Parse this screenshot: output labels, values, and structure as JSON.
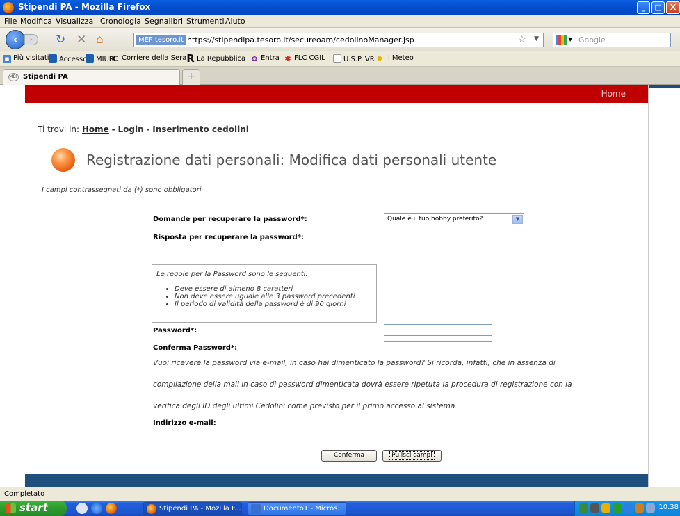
{
  "window": {
    "title": "Stipendi PA - Mozilla Firefox",
    "minimize": "_",
    "maximize": "□",
    "close": "X"
  },
  "menu": [
    "File",
    "Modifica",
    "Visualizza",
    "Cronologia",
    "Segnalibri",
    "Strumenti",
    "Aiuto"
  ],
  "nav": {
    "site_badge": "MEF tesoro.it",
    "url": "https://stipendipa.tesoro.it/secureoam/cedolinoManager.jsp",
    "search_engine": "Google"
  },
  "bookmarks": [
    "Più visitati",
    "Accesso",
    "MIUR",
    "Corriere della Sera",
    "La Repubblica",
    "Entra",
    "FLC CGIL",
    "U.S.P. VR",
    "Il Meteo"
  ],
  "tab": {
    "favicon": "MEF",
    "title": "Stipendi PA",
    "newtab": "+"
  },
  "header": {
    "home_link": "Home"
  },
  "breadcrumb": {
    "prefix": "Ti trovi in:",
    "home": "Home",
    "sep1": "-",
    "login": "Login",
    "sep2": "-",
    "current": "Inserimento cedolini"
  },
  "page": {
    "title": "Registrazione dati personali: Modifica dati personali utente",
    "required_note": "I campi contrassegnati da (*) sono obbligatori"
  },
  "form": {
    "question_label": "Domande per recuperare la password*:",
    "question_value": "Quale è il tuo hobby preferito?",
    "answer_label": "Risposta per recuperare la password*:",
    "rules_intro": "Le regole per la Password sono le seguenti:",
    "rules": [
      "Deve essere di almeno 8 caratteri",
      "Non deve essere uguale alle 3 password precedenti",
      "Il periodo di validità della password è di 90 giorni"
    ],
    "password_label": "Password*:",
    "confirm_label": "Conferma Password*:",
    "email_info_1": "Vuoi ricevere la password via e-mail, in caso hai dimenticato la password? Si ricorda, infatti, che in assenza di",
    "email_info_2": "compilazione della mail in caso di password dimenticata dovrà essere ripetuta la procedura di registrazione con la",
    "email_info_3": "verifica degli ID degli ultimi Cedolini come previsto per il primo accesso al sistema",
    "email_label": "Indirizzo e-mail:",
    "confirm_button": "Conferma",
    "reset_button": "Pulisci campi"
  },
  "status": {
    "text": "Completato"
  },
  "taskbar": {
    "start": "start",
    "items": [
      "Stipendi PA - Mozilla F...",
      "Documento1 - Micros..."
    ],
    "clock": "10.38"
  },
  "colors": {
    "header_red": "#c00000",
    "footer_blue": "#1e4f7d",
    "orb_orange": "#e35a0a"
  }
}
